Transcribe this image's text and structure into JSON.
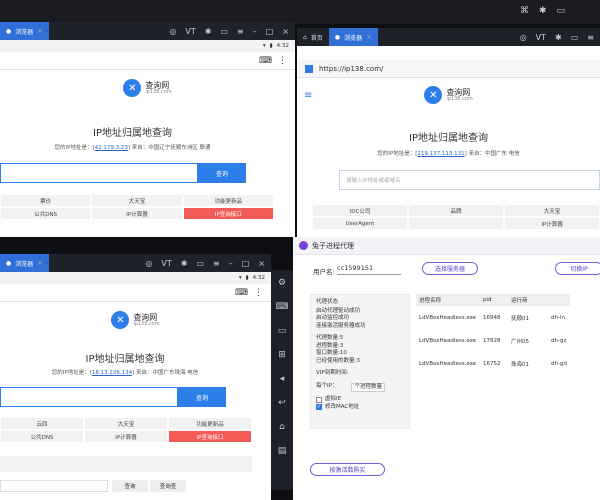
{
  "host": {
    "top_icons": [
      "gamepad-icon",
      "vt-icon",
      "settings-icon",
      "screen-icon",
      "menu-icon",
      "minimize-icon",
      "maximize-icon",
      "close-icon"
    ]
  },
  "win1": {
    "tab": "浏览器",
    "time": "4:32",
    "logo_name": "查询网",
    "logo_domain": "ip138.com",
    "title": "IP地址归属地查询",
    "ip_prefix": "您的IP地址是：[",
    "ip": "42.179.3.23",
    "ip_suffix": "] 来自：中国辽宁抚顺东洲区 联通",
    "query": "查询",
    "grid": [
      "票价",
      "大天宝",
      "功能更新品",
      "公共DNS",
      "IP计算器",
      "IP查询接口"
    ]
  },
  "win2": {
    "tab_home": "首页",
    "tab_browser": "浏览器",
    "url": "https://ip138.com/",
    "logo_name": "查询网",
    "logo_domain": "ip138.com",
    "title": "IP地址归属地查询",
    "ip_prefix": "您的IP地址是：[",
    "ip": "219.137.113.131",
    "ip_suffix": "] 来自：中国广东 电信",
    "placeholder": "请输入IP地址或者域名",
    "grid": [
      "IDC公司",
      "品牌",
      "大天宝",
      "UserAgent",
      "",
      "IP计算器"
    ]
  },
  "win3": {
    "tab": "浏览器",
    "time": "4:32",
    "logo_name": "查询网",
    "logo_domain": "ip138.com",
    "title": "IP地址归属地查询",
    "ip_prefix": "您的IP地址是：[",
    "ip": "18.13.226.134",
    "ip_suffix": "] 来自：中国广东珠海 电信",
    "query": "查询",
    "grid": [
      "云四",
      "大天宝",
      "功能更新品",
      "公共DNS",
      "IP计算器",
      "IP查询接口"
    ],
    "bottom_btns": [
      "查询",
      "查询查"
    ]
  },
  "proxy": {
    "title": "兔子进程代理",
    "user_label": "用户名:",
    "user": "cc1599151",
    "btn_select": "选择服务器",
    "btn_switch": "切换IP",
    "status_lines": [
      "代理状态",
      "启动代理驱动成功",
      "启动监控成功",
      "连接激活服务器成功",
      "代理数量:5",
      "进程数量:3",
      "窗口数量:10",
      "已经使用的数量:3",
      "VIP到期时间:"
    ],
    "per_ip_label": "每个IP：",
    "per_ip_value": "个进程数量",
    "chk1": "虚拟IE",
    "chk2": "修改MAC地址",
    "buy": "按激活数购买",
    "headers": [
      "进程名称",
      "pid",
      "运行商",
      ""
    ],
    "rows": [
      [
        "LdVBoxHeadless.exe",
        "16948",
        "抚顺01",
        "dh-ln"
      ],
      [
        "LdVBoxHeadless.exe",
        "17828",
        "广州05",
        "dh-gz"
      ],
      [
        "LdVBoxHeadless.exe",
        "16752",
        "珠海01",
        "dh-gd"
      ]
    ]
  }
}
